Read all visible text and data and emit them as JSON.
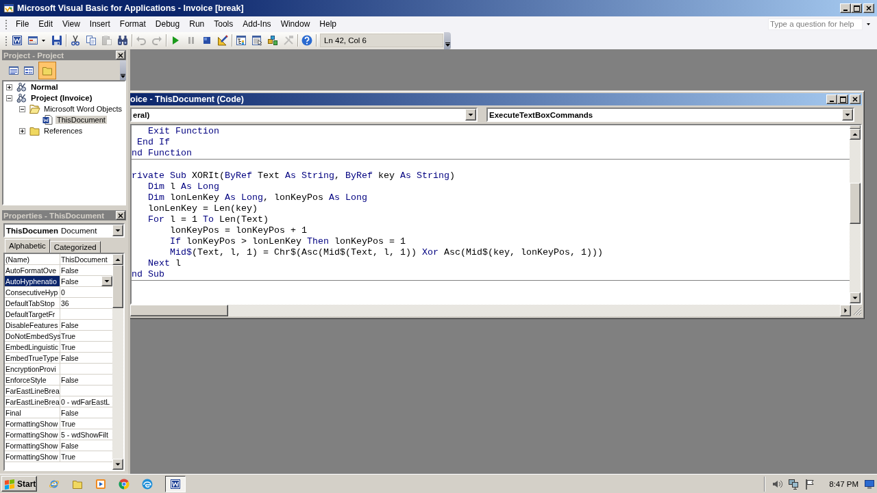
{
  "window": {
    "title": "Microsoft Visual Basic for Applications - Invoice [break]"
  },
  "menu": {
    "items": [
      "File",
      "Edit",
      "View",
      "Insert",
      "Format",
      "Debug",
      "Run",
      "Tools",
      "Add-Ins",
      "Window",
      "Help"
    ],
    "help_box": {
      "placeholder": "Type a question for help"
    }
  },
  "toolbar": {
    "groups": [
      [
        {
          "disabled": false
        },
        {
          "disabled": false
        },
        {
          "disabled": false
        }
      ],
      [
        {
          "disabled": false
        },
        {
          "disabled": false
        },
        {
          "disabled": true
        },
        {
          "disabled": false
        }
      ],
      [
        {
          "disabled": true
        },
        {
          "disabled": true
        }
      ],
      [
        {
          "disabled": false
        },
        {
          "disabled": true
        },
        {
          "disabled": false
        },
        {
          "disabled": false
        }
      ],
      [
        {
          "disabled": false
        },
        {
          "disabled": false
        },
        {
          "disabled": false
        },
        {
          "disabled": true
        }
      ],
      [
        {
          "disabled": false
        }
      ]
    ],
    "position": "Ln 42, Col 6"
  },
  "project": {
    "title": "Project - Project",
    "toolbar": [
      {
        "pressed": false
      },
      {
        "pressed": false
      },
      {
        "pressed": true
      }
    ],
    "tree": [
      {
        "label": "Normal",
        "kind": "project",
        "expanded": false,
        "selected": false
      },
      {
        "label": "Project (Invoice)",
        "kind": "project",
        "expanded": true,
        "selected": false,
        "children": [
          {
            "label": "Microsoft Word Objects",
            "kind": "folder",
            "expanded": true,
            "selected": false,
            "children": [
              {
                "label": "ThisDocument",
                "kind": "document",
                "selected": true
              }
            ]
          },
          {
            "label": "References",
            "kind": "folder",
            "expanded": false,
            "selected": false
          }
        ]
      }
    ]
  },
  "properties": {
    "title": "Properties - ThisDocument",
    "object": {
      "name": "ThisDocumen",
      "type": "Document"
    },
    "tabs": [
      {
        "label": "Alphabetic",
        "selected": true
      },
      {
        "label": "Categorized",
        "selected": false
      }
    ],
    "rows": [
      {
        "name": "(Name)",
        "value": "ThisDocument",
        "selected": false
      },
      {
        "name": "AutoFormatOve",
        "value": "False",
        "selected": false
      },
      {
        "name": "AutoHyphenatio",
        "value": "False",
        "selected": true
      },
      {
        "name": "ConsecutiveHyp",
        "value": "0",
        "selected": false
      },
      {
        "name": "DefaultTabStop",
        "value": "36",
        "selected": false
      },
      {
        "name": "DefaultTargetFr",
        "selected": false
      },
      {
        "name": "DisableFeatures",
        "value": "False",
        "selected": false
      },
      {
        "name": "DoNotEmbedSys",
        "value": "True",
        "selected": false
      },
      {
        "name": "EmbedLinguistic",
        "value": "True",
        "selected": false
      },
      {
        "name": "EmbedTrueType",
        "value": "False",
        "selected": false
      },
      {
        "name": "EncryptionProvi",
        "selected": false
      },
      {
        "name": "EnforceStyle",
        "value": "False",
        "selected": false
      },
      {
        "name": "FarEastLineBrea",
        "selected": false
      },
      {
        "name": "FarEastLineBrea",
        "value": "0 - wdFarEastL",
        "selected": false
      },
      {
        "name": "Final",
        "value": "False",
        "selected": false
      },
      {
        "name": "FormattingShow",
        "value": "True",
        "selected": false
      },
      {
        "name": "FormattingShow",
        "value": "5 - wdShowFilt",
        "selected": false
      },
      {
        "name": "FormattingShow",
        "value": "False",
        "selected": false
      },
      {
        "name": "FormattingShow",
        "value": "True",
        "selected": false
      }
    ]
  },
  "code_window": {
    "title": "oice - ThisDocument (Code)",
    "object_combo": "eral)",
    "procedure_combo": "ExecuteTextBoxCommands",
    "procedures": [
      {
        "lines": [
          {
            "kind": "code",
            "segments": [
              {
                "text": "   Exit Function",
                "kind": "keyword"
              }
            ]
          },
          {
            "kind": "code",
            "segments": [
              {
                "text": " End If",
                "kind": "keyword"
              }
            ]
          },
          {
            "kind": "code",
            "segments": [
              {
                "text": "nd Function",
                "kind": "keyword"
              }
            ]
          }
        ]
      },
      {
        "lines": [
          {
            "kind": "blank"
          },
          {
            "kind": "code",
            "segments": [
              {
                "text": "rivate Sub",
                "kind": "keyword"
              },
              {
                "text": " XORIt(",
                "kind": "plain"
              },
              {
                "text": "ByRef",
                "kind": "keyword"
              },
              {
                "text": " Text ",
                "kind": "plain"
              },
              {
                "text": "As String",
                "kind": "keyword"
              },
              {
                "text": ", ",
                "kind": "plain"
              },
              {
                "text": "ByRef",
                "kind": "keyword"
              },
              {
                "text": " key ",
                "kind": "plain"
              },
              {
                "text": "As String",
                "kind": "keyword"
              },
              {
                "text": ")",
                "kind": "plain"
              }
            ]
          },
          {
            "kind": "code",
            "segments": [
              {
                "text": "   Dim",
                "kind": "keyword"
              },
              {
                "text": " l ",
                "kind": "plain"
              },
              {
                "text": "As Long",
                "kind": "keyword"
              }
            ]
          },
          {
            "kind": "code",
            "segments": [
              {
                "text": "   Dim",
                "kind": "keyword"
              },
              {
                "text": " lonLenKey ",
                "kind": "plain"
              },
              {
                "text": "As Long",
                "kind": "keyword"
              },
              {
                "text": ", lonKeyPos ",
                "kind": "plain"
              },
              {
                "text": "As Long",
                "kind": "keyword"
              }
            ]
          },
          {
            "kind": "code",
            "segments": [
              {
                "text": "   lonLenKey = Len(key)",
                "kind": "plain"
              }
            ]
          },
          {
            "kind": "code",
            "segments": [
              {
                "text": "   For",
                "kind": "keyword"
              },
              {
                "text": " l = 1 ",
                "kind": "plain"
              },
              {
                "text": "To",
                "kind": "keyword"
              },
              {
                "text": " Len(Text)",
                "kind": "plain"
              }
            ]
          },
          {
            "kind": "code",
            "segments": [
              {
                "text": "       lonKeyPos = lonKeyPos + 1",
                "kind": "plain"
              }
            ]
          },
          {
            "kind": "code",
            "segments": [
              {
                "text": "       If",
                "kind": "keyword"
              },
              {
                "text": " lonKeyPos > lonLenKey ",
                "kind": "plain"
              },
              {
                "text": "Then",
                "kind": "keyword"
              },
              {
                "text": " lonKeyPos = 1",
                "kind": "plain"
              }
            ]
          },
          {
            "kind": "code",
            "segments": [
              {
                "text": "       Mid$",
                "kind": "keyword"
              },
              {
                "text": "(Text, l, 1) = Chr$(Asc(Mid$(Text, l, 1)) ",
                "kind": "plain"
              },
              {
                "text": "Xor",
                "kind": "keyword"
              },
              {
                "text": " Asc(Mid$(key, lonKeyPos, 1)))",
                "kind": "plain"
              }
            ]
          },
          {
            "kind": "code",
            "segments": [
              {
                "text": "   Next",
                "kind": "keyword"
              },
              {
                "text": " l",
                "kind": "plain"
              }
            ]
          },
          {
            "kind": "code",
            "segments": [
              {
                "text": "nd Sub",
                "kind": "keyword"
              }
            ]
          }
        ]
      }
    ]
  },
  "taskbar": {
    "start": "Start",
    "tasks": [
      {
        "active": true
      }
    ],
    "clock": "8:47 PM"
  }
}
